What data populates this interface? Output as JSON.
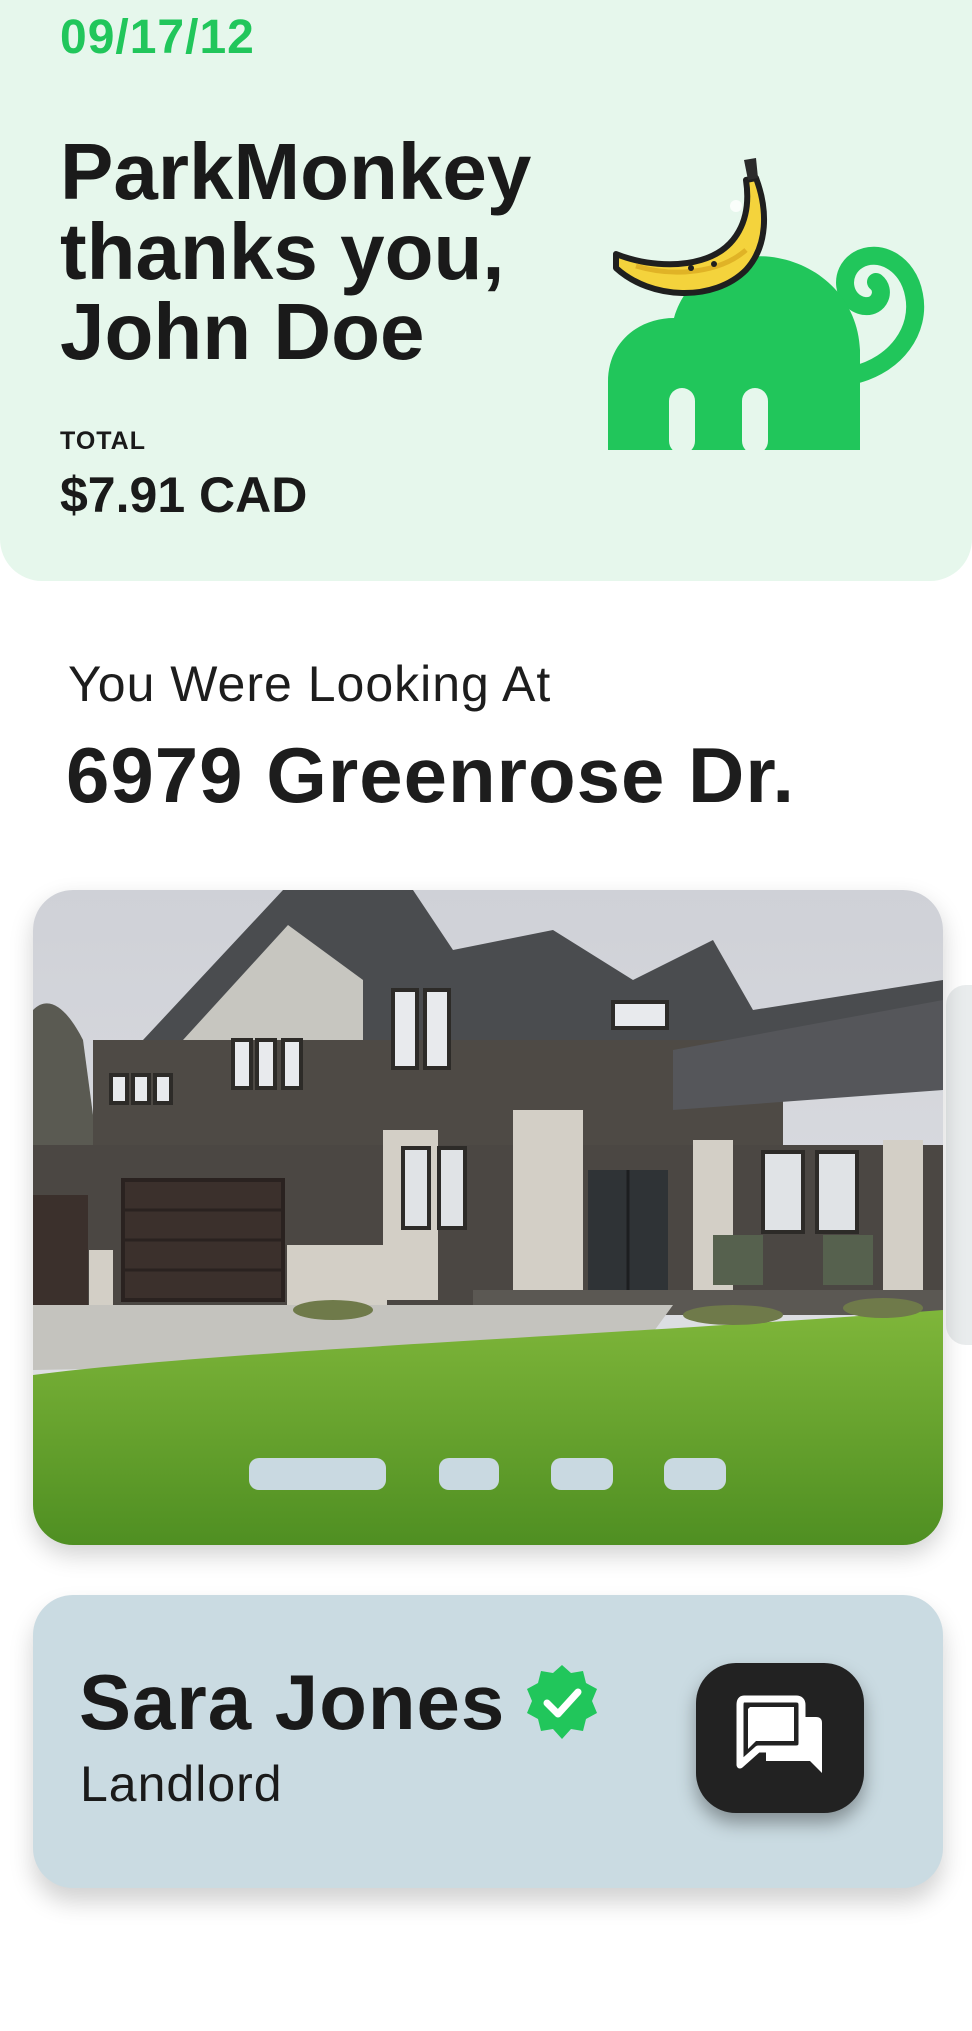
{
  "receipt": {
    "date": "09/17/12",
    "thanks_lines": [
      "ParkMonkey",
      "thanks you,",
      "John Doe"
    ],
    "total_label": "TOTAL",
    "total_value": "$7.91 CAD",
    "brand_color": "#21c65b",
    "background": "#e6f7ec"
  },
  "listing": {
    "looking_label": "You Were Looking At",
    "address": "6979 Greenrose Dr.",
    "carousel": {
      "slide_count": 4,
      "active_index": 0
    }
  },
  "landlord": {
    "name": "Sara Jones",
    "role": "Landlord",
    "verified": true,
    "verified_icon": "verified-badge-icon",
    "chat_icon": "chat-bubbles-icon",
    "card_color": "#cadbe2"
  }
}
